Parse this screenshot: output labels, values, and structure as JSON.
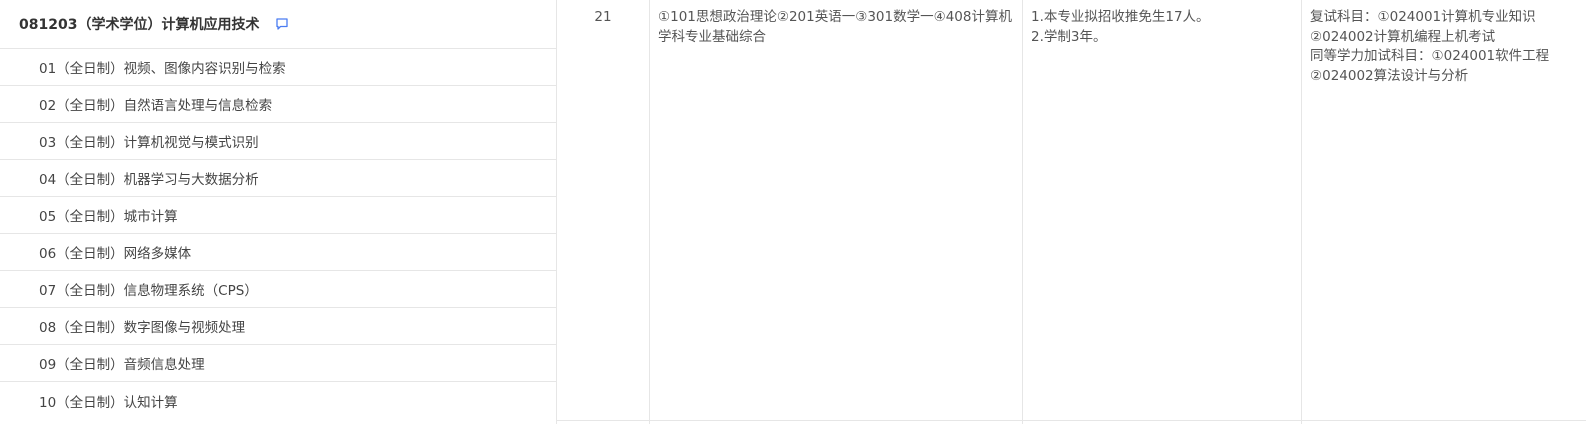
{
  "major": {
    "title": "081203（学术学位）计算机应用技术",
    "comment_icon": "comment-icon",
    "directions": [
      "01（全日制）视频、图像内容识别与检索",
      "02（全日制）自然语言处理与信息检索",
      "03（全日制）计算机视觉与模式识别",
      "04（全日制）机器学习与大数据分析",
      "05（全日制）城市计算",
      "06（全日制）网络多媒体",
      "07（全日制）信息物理系统（CPS）",
      "08（全日制）数字图像与视频处理",
      "09（全日制）音频信息处理",
      "10（全日制）认知计算"
    ]
  },
  "quota": "21",
  "exam_subjects": "①101思想政治理论②201英语一③301数学一④408计算机学科专业基础综合",
  "notes": [
    "1.本专业拟招收推免生17人。",
    "2.学制3年。"
  ],
  "retest": [
    "复试科目：①024001计算机专业知识",
    "②024002计算机编程上机考试",
    "同等学力加试科目：①024001软件工程",
    "②024002算法设计与分析"
  ],
  "colors": {
    "border": "#e6e6e6",
    "icon": "#4a7cf2",
    "text": "#333333"
  }
}
